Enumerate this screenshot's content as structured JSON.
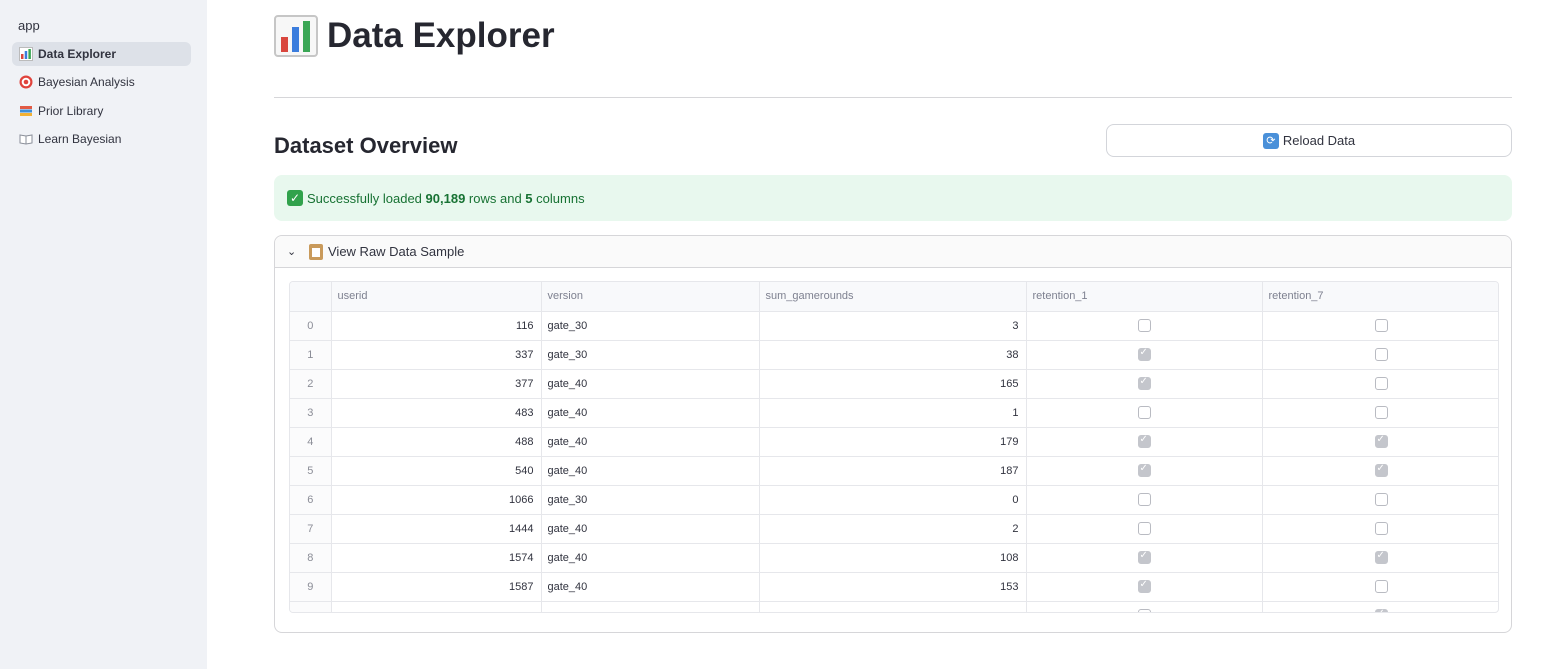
{
  "sidebar": {
    "app_label": "app",
    "items": [
      {
        "label": "Data Explorer",
        "icon": "bar-chart-icon",
        "active": true
      },
      {
        "label": "Bayesian Analysis",
        "icon": "target-icon",
        "active": false
      },
      {
        "label": "Prior Library",
        "icon": "books-icon",
        "active": false
      },
      {
        "label": "Learn Bayesian",
        "icon": "open-book-icon",
        "active": false
      }
    ]
  },
  "page": {
    "title": "Data Explorer",
    "section_title": "Dataset Overview",
    "reload_label": "Reload Data",
    "success_prefix": "Successfully loaded",
    "success_rows": "90,189",
    "success_mid": "rows and",
    "success_cols": "5",
    "success_suffix": "columns",
    "expander_label": "View Raw Data Sample"
  },
  "table": {
    "columns": [
      "",
      "userid",
      "version",
      "sum_gamerounds",
      "retention_1",
      "retention_7"
    ],
    "rows": [
      {
        "idx": "0",
        "userid": "116",
        "version": "gate_30",
        "sum": "3",
        "r1": false,
        "r7": false
      },
      {
        "idx": "1",
        "userid": "337",
        "version": "gate_30",
        "sum": "38",
        "r1": true,
        "r7": false
      },
      {
        "idx": "2",
        "userid": "377",
        "version": "gate_40",
        "sum": "165",
        "r1": true,
        "r7": false
      },
      {
        "idx": "3",
        "userid": "483",
        "version": "gate_40",
        "sum": "1",
        "r1": false,
        "r7": false
      },
      {
        "idx": "4",
        "userid": "488",
        "version": "gate_40",
        "sum": "179",
        "r1": true,
        "r7": true
      },
      {
        "idx": "5",
        "userid": "540",
        "version": "gate_40",
        "sum": "187",
        "r1": true,
        "r7": true
      },
      {
        "idx": "6",
        "userid": "1066",
        "version": "gate_30",
        "sum": "0",
        "r1": false,
        "r7": false
      },
      {
        "idx": "7",
        "userid": "1444",
        "version": "gate_40",
        "sum": "2",
        "r1": false,
        "r7": false
      },
      {
        "idx": "8",
        "userid": "1574",
        "version": "gate_40",
        "sum": "108",
        "r1": true,
        "r7": true
      },
      {
        "idx": "9",
        "userid": "1587",
        "version": "gate_40",
        "sum": "153",
        "r1": true,
        "r7": false
      },
      {
        "idx": "",
        "userid": "",
        "version": "",
        "sum": "",
        "r1": false,
        "r7": true
      }
    ]
  },
  "colors": {
    "accent_green": "#31a24c",
    "sidebar_bg": "#f0f2f6",
    "success_bg": "#e8f8ee"
  }
}
